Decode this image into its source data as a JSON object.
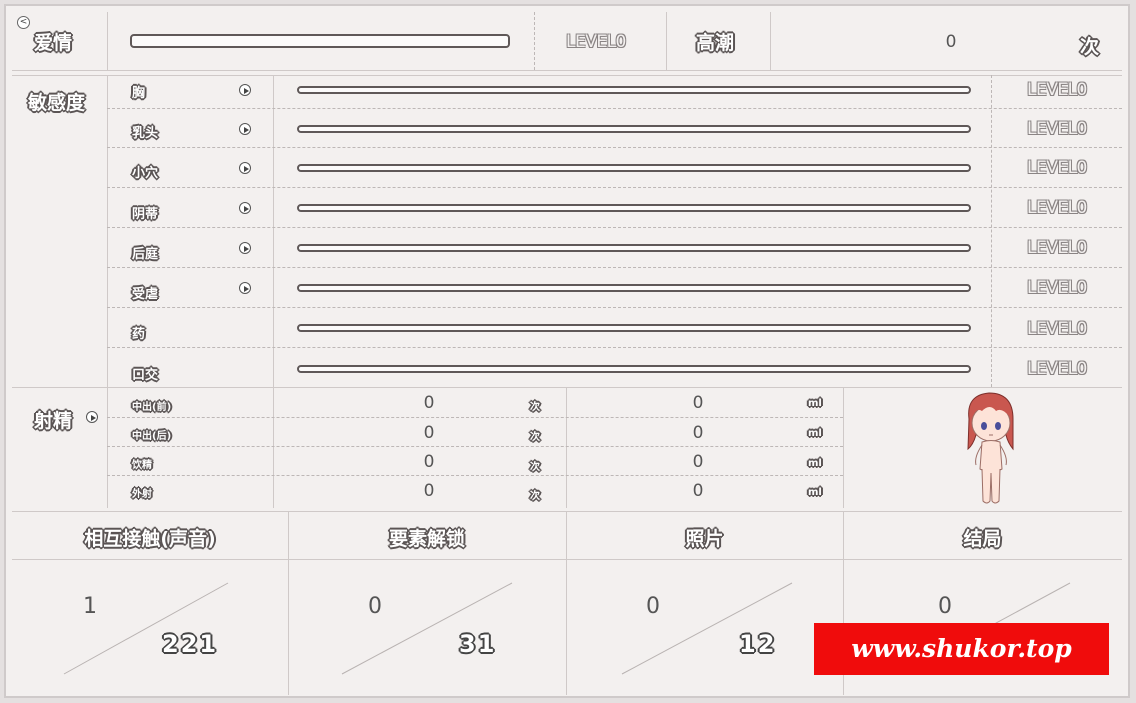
{
  "header": {
    "love_label": "爱情",
    "love_level": "LEVEL0",
    "climax_label": "高潮",
    "climax_count": "0",
    "climax_unit": "次"
  },
  "sensitivity": {
    "label": "敏感度",
    "items": [
      {
        "label": "胸",
        "level": "LEVEL0",
        "has_arrow": true,
        "progress": 0
      },
      {
        "label": "乳头",
        "level": "LEVEL0",
        "has_arrow": true,
        "progress": 0
      },
      {
        "label": "小穴",
        "level": "LEVEL0",
        "has_arrow": true,
        "progress": 0
      },
      {
        "label": "阴蒂",
        "level": "LEVEL0",
        "has_arrow": true,
        "progress": 0
      },
      {
        "label": "后庭",
        "level": "LEVEL0",
        "has_arrow": true,
        "progress": 0
      },
      {
        "label": "受虐",
        "level": "LEVEL0",
        "has_arrow": true,
        "progress": 0
      },
      {
        "label": "药",
        "level": "LEVEL0",
        "has_arrow": false,
        "progress": 0
      },
      {
        "label": "口交",
        "level": "LEVEL0",
        "has_arrow": false,
        "progress": 0
      }
    ]
  },
  "ejaculation": {
    "label": "射精",
    "rows": [
      {
        "label": "中出(前)",
        "count": "0",
        "count_unit": "次",
        "volume": "0",
        "volume_unit": "ml"
      },
      {
        "label": "中出(后)",
        "count": "0",
        "count_unit": "次",
        "volume": "0",
        "volume_unit": "ml"
      },
      {
        "label": "饮精",
        "count": "0",
        "count_unit": "次",
        "volume": "0",
        "volume_unit": "ml"
      },
      {
        "label": "外射",
        "count": "0",
        "count_unit": "次",
        "volume": "0",
        "volume_unit": "ml"
      }
    ]
  },
  "stats": [
    {
      "label": "相互接触(声音)",
      "current": "1",
      "total": "221"
    },
    {
      "label": "要素解锁",
      "current": "0",
      "total": "31"
    },
    {
      "label": "照片",
      "current": "0",
      "total": "12"
    },
    {
      "label": "结局",
      "current": "0",
      "total": ""
    }
  ],
  "back_button": "<",
  "watermark": "www.shukor.top",
  "colors": {
    "bar_border": "#5f5858",
    "background": "#f3f0ef",
    "watermark_bg": "#f00c0c",
    "character_hair": "#c9574f"
  }
}
